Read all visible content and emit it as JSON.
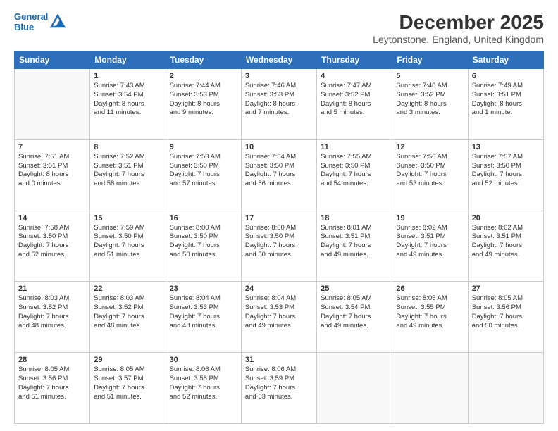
{
  "logo": {
    "line1": "General",
    "line2": "Blue"
  },
  "title": "December 2025",
  "subtitle": "Leytonstone, England, United Kingdom",
  "weekdays": [
    "Sunday",
    "Monday",
    "Tuesday",
    "Wednesday",
    "Thursday",
    "Friday",
    "Saturday"
  ],
  "weeks": [
    [
      {
        "day": "",
        "info": ""
      },
      {
        "day": "1",
        "info": "Sunrise: 7:43 AM\nSunset: 3:54 PM\nDaylight: 8 hours\nand 11 minutes."
      },
      {
        "day": "2",
        "info": "Sunrise: 7:44 AM\nSunset: 3:53 PM\nDaylight: 8 hours\nand 9 minutes."
      },
      {
        "day": "3",
        "info": "Sunrise: 7:46 AM\nSunset: 3:53 PM\nDaylight: 8 hours\nand 7 minutes."
      },
      {
        "day": "4",
        "info": "Sunrise: 7:47 AM\nSunset: 3:52 PM\nDaylight: 8 hours\nand 5 minutes."
      },
      {
        "day": "5",
        "info": "Sunrise: 7:48 AM\nSunset: 3:52 PM\nDaylight: 8 hours\nand 3 minutes."
      },
      {
        "day": "6",
        "info": "Sunrise: 7:49 AM\nSunset: 3:51 PM\nDaylight: 8 hours\nand 1 minute."
      }
    ],
    [
      {
        "day": "7",
        "info": "Sunrise: 7:51 AM\nSunset: 3:51 PM\nDaylight: 8 hours\nand 0 minutes."
      },
      {
        "day": "8",
        "info": "Sunrise: 7:52 AM\nSunset: 3:51 PM\nDaylight: 7 hours\nand 58 minutes."
      },
      {
        "day": "9",
        "info": "Sunrise: 7:53 AM\nSunset: 3:50 PM\nDaylight: 7 hours\nand 57 minutes."
      },
      {
        "day": "10",
        "info": "Sunrise: 7:54 AM\nSunset: 3:50 PM\nDaylight: 7 hours\nand 56 minutes."
      },
      {
        "day": "11",
        "info": "Sunrise: 7:55 AM\nSunset: 3:50 PM\nDaylight: 7 hours\nand 54 minutes."
      },
      {
        "day": "12",
        "info": "Sunrise: 7:56 AM\nSunset: 3:50 PM\nDaylight: 7 hours\nand 53 minutes."
      },
      {
        "day": "13",
        "info": "Sunrise: 7:57 AM\nSunset: 3:50 PM\nDaylight: 7 hours\nand 52 minutes."
      }
    ],
    [
      {
        "day": "14",
        "info": "Sunrise: 7:58 AM\nSunset: 3:50 PM\nDaylight: 7 hours\nand 52 minutes."
      },
      {
        "day": "15",
        "info": "Sunrise: 7:59 AM\nSunset: 3:50 PM\nDaylight: 7 hours\nand 51 minutes."
      },
      {
        "day": "16",
        "info": "Sunrise: 8:00 AM\nSunset: 3:50 PM\nDaylight: 7 hours\nand 50 minutes."
      },
      {
        "day": "17",
        "info": "Sunrise: 8:00 AM\nSunset: 3:50 PM\nDaylight: 7 hours\nand 50 minutes."
      },
      {
        "day": "18",
        "info": "Sunrise: 8:01 AM\nSunset: 3:51 PM\nDaylight: 7 hours\nand 49 minutes."
      },
      {
        "day": "19",
        "info": "Sunrise: 8:02 AM\nSunset: 3:51 PM\nDaylight: 7 hours\nand 49 minutes."
      },
      {
        "day": "20",
        "info": "Sunrise: 8:02 AM\nSunset: 3:51 PM\nDaylight: 7 hours\nand 49 minutes."
      }
    ],
    [
      {
        "day": "21",
        "info": "Sunrise: 8:03 AM\nSunset: 3:52 PM\nDaylight: 7 hours\nand 48 minutes."
      },
      {
        "day": "22",
        "info": "Sunrise: 8:03 AM\nSunset: 3:52 PM\nDaylight: 7 hours\nand 48 minutes."
      },
      {
        "day": "23",
        "info": "Sunrise: 8:04 AM\nSunset: 3:53 PM\nDaylight: 7 hours\nand 48 minutes."
      },
      {
        "day": "24",
        "info": "Sunrise: 8:04 AM\nSunset: 3:53 PM\nDaylight: 7 hours\nand 49 minutes."
      },
      {
        "day": "25",
        "info": "Sunrise: 8:05 AM\nSunset: 3:54 PM\nDaylight: 7 hours\nand 49 minutes."
      },
      {
        "day": "26",
        "info": "Sunrise: 8:05 AM\nSunset: 3:55 PM\nDaylight: 7 hours\nand 49 minutes."
      },
      {
        "day": "27",
        "info": "Sunrise: 8:05 AM\nSunset: 3:56 PM\nDaylight: 7 hours\nand 50 minutes."
      }
    ],
    [
      {
        "day": "28",
        "info": "Sunrise: 8:05 AM\nSunset: 3:56 PM\nDaylight: 7 hours\nand 51 minutes."
      },
      {
        "day": "29",
        "info": "Sunrise: 8:05 AM\nSunset: 3:57 PM\nDaylight: 7 hours\nand 51 minutes."
      },
      {
        "day": "30",
        "info": "Sunrise: 8:06 AM\nSunset: 3:58 PM\nDaylight: 7 hours\nand 52 minutes."
      },
      {
        "day": "31",
        "info": "Sunrise: 8:06 AM\nSunset: 3:59 PM\nDaylight: 7 hours\nand 53 minutes."
      },
      {
        "day": "",
        "info": ""
      },
      {
        "day": "",
        "info": ""
      },
      {
        "day": "",
        "info": ""
      }
    ]
  ]
}
